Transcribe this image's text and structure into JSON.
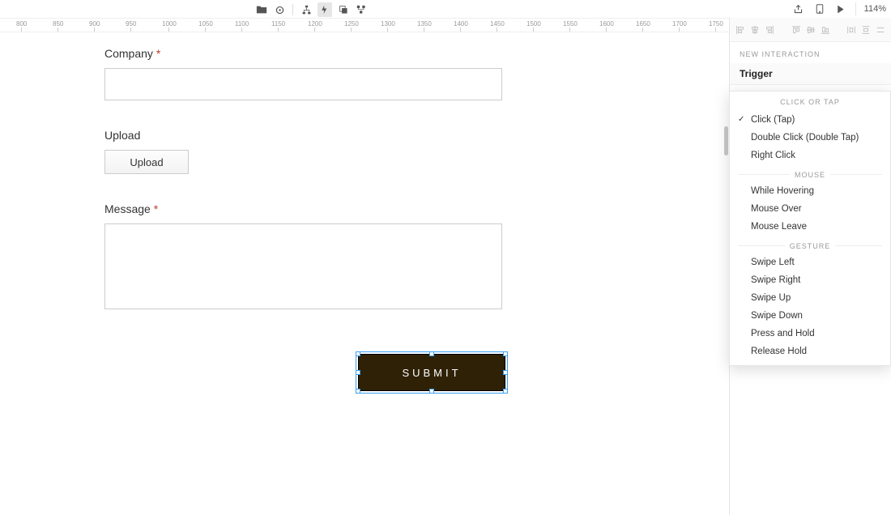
{
  "toolbar": {
    "zoom": "114%"
  },
  "ruler": {
    "start": 800,
    "step": 50,
    "count": 22
  },
  "form": {
    "company_label": "Company",
    "upload_label": "Upload",
    "upload_button": "Upload",
    "message_label": "Message",
    "submit_label": "SUBMIT",
    "required_mark": "*"
  },
  "panel": {
    "section_title": "NEW INTERACTION",
    "trigger_label": "Trigger"
  },
  "dropdown": {
    "group_click": "CLICK OR TAP",
    "group_mouse": "MOUSE",
    "group_gesture": "GESTURE",
    "items_click": [
      {
        "label": "Click (Tap)",
        "checked": true
      },
      {
        "label": "Double Click (Double Tap)",
        "checked": false
      },
      {
        "label": "Right Click",
        "checked": false
      }
    ],
    "items_mouse": [
      {
        "label": "While Hovering"
      },
      {
        "label": "Mouse Over"
      },
      {
        "label": "Mouse Leave"
      }
    ],
    "items_gesture": [
      {
        "label": "Swipe Left"
      },
      {
        "label": "Swipe Right"
      },
      {
        "label": "Swipe Up"
      },
      {
        "label": "Swipe Down"
      },
      {
        "label": "Press and Hold"
      },
      {
        "label": "Release Hold"
      }
    ]
  }
}
